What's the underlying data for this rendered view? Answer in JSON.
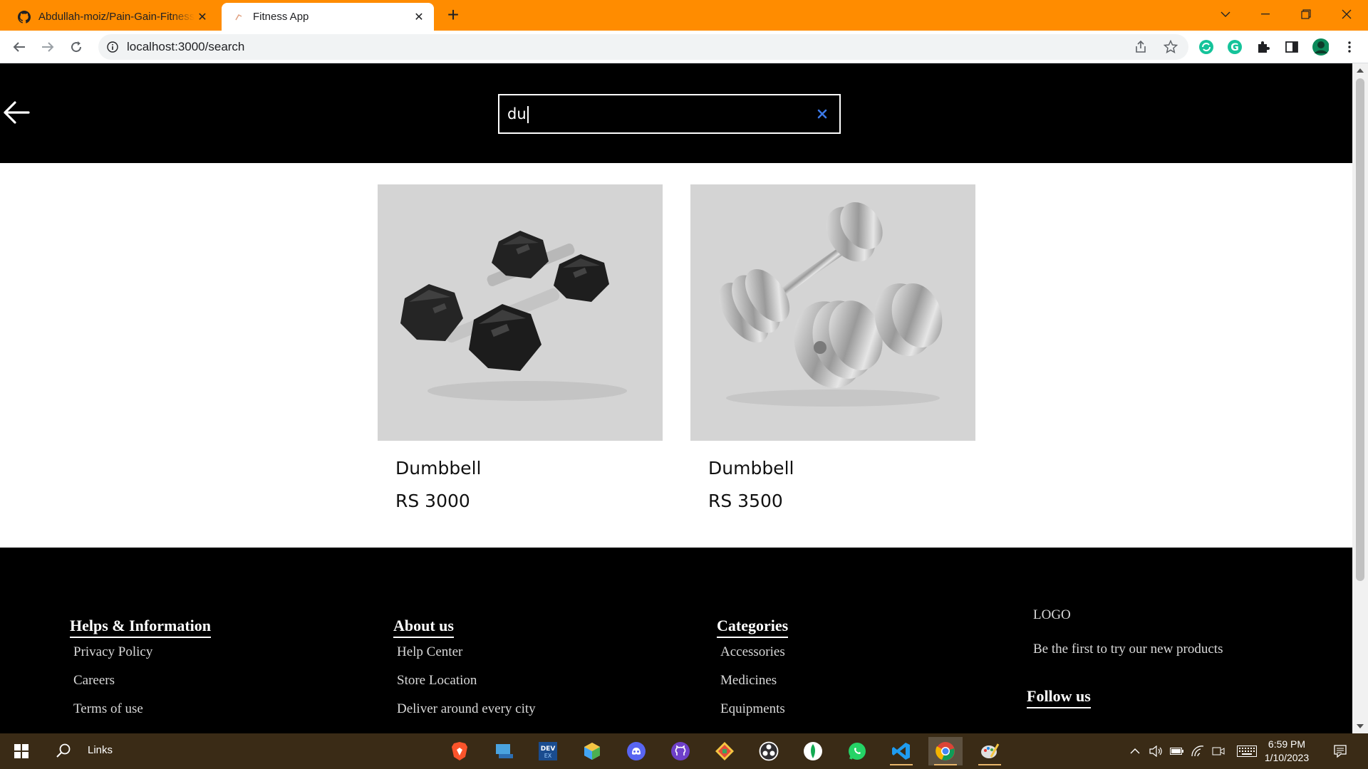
{
  "browser": {
    "tabs": [
      {
        "title": "Abdullah-moiz/Pain-Gain-Fitness",
        "icon": "github-icon",
        "active": false
      },
      {
        "title": "Fitness App",
        "icon": "favicon-icon",
        "active": true
      }
    ],
    "url": "localhost:3000/search"
  },
  "header": {
    "search_value": "du"
  },
  "results": [
    {
      "name": "Dumbbell",
      "price": "RS 3000",
      "image": "hex-dumbbells-image"
    },
    {
      "name": "Dumbbell",
      "price": "RS 3500",
      "image": "chrome-dumbbells-image"
    }
  ],
  "footer": {
    "columns": [
      {
        "heading": "Helps & Information",
        "links": [
          "Privacy Policy",
          "Careers",
          "Terms of use"
        ]
      },
      {
        "heading": "About us",
        "links": [
          "Help Center",
          "Store Location",
          "Deliver around every city"
        ]
      },
      {
        "heading": "Categories",
        "links": [
          "Accessories",
          "Medicines",
          "Equipments"
        ]
      }
    ],
    "logo": "LOGO",
    "tagline": "Be the first to try our new products",
    "follow_heading": "Follow us"
  },
  "taskbar": {
    "search_label": "Links",
    "time": "6:59 PM",
    "date": "1/10/2023"
  },
  "colors": {
    "tabbar": "#ff8c00",
    "taskbar": "#3a2b16",
    "header_bg": "#000000",
    "clear_icon": "#3b78e7"
  }
}
